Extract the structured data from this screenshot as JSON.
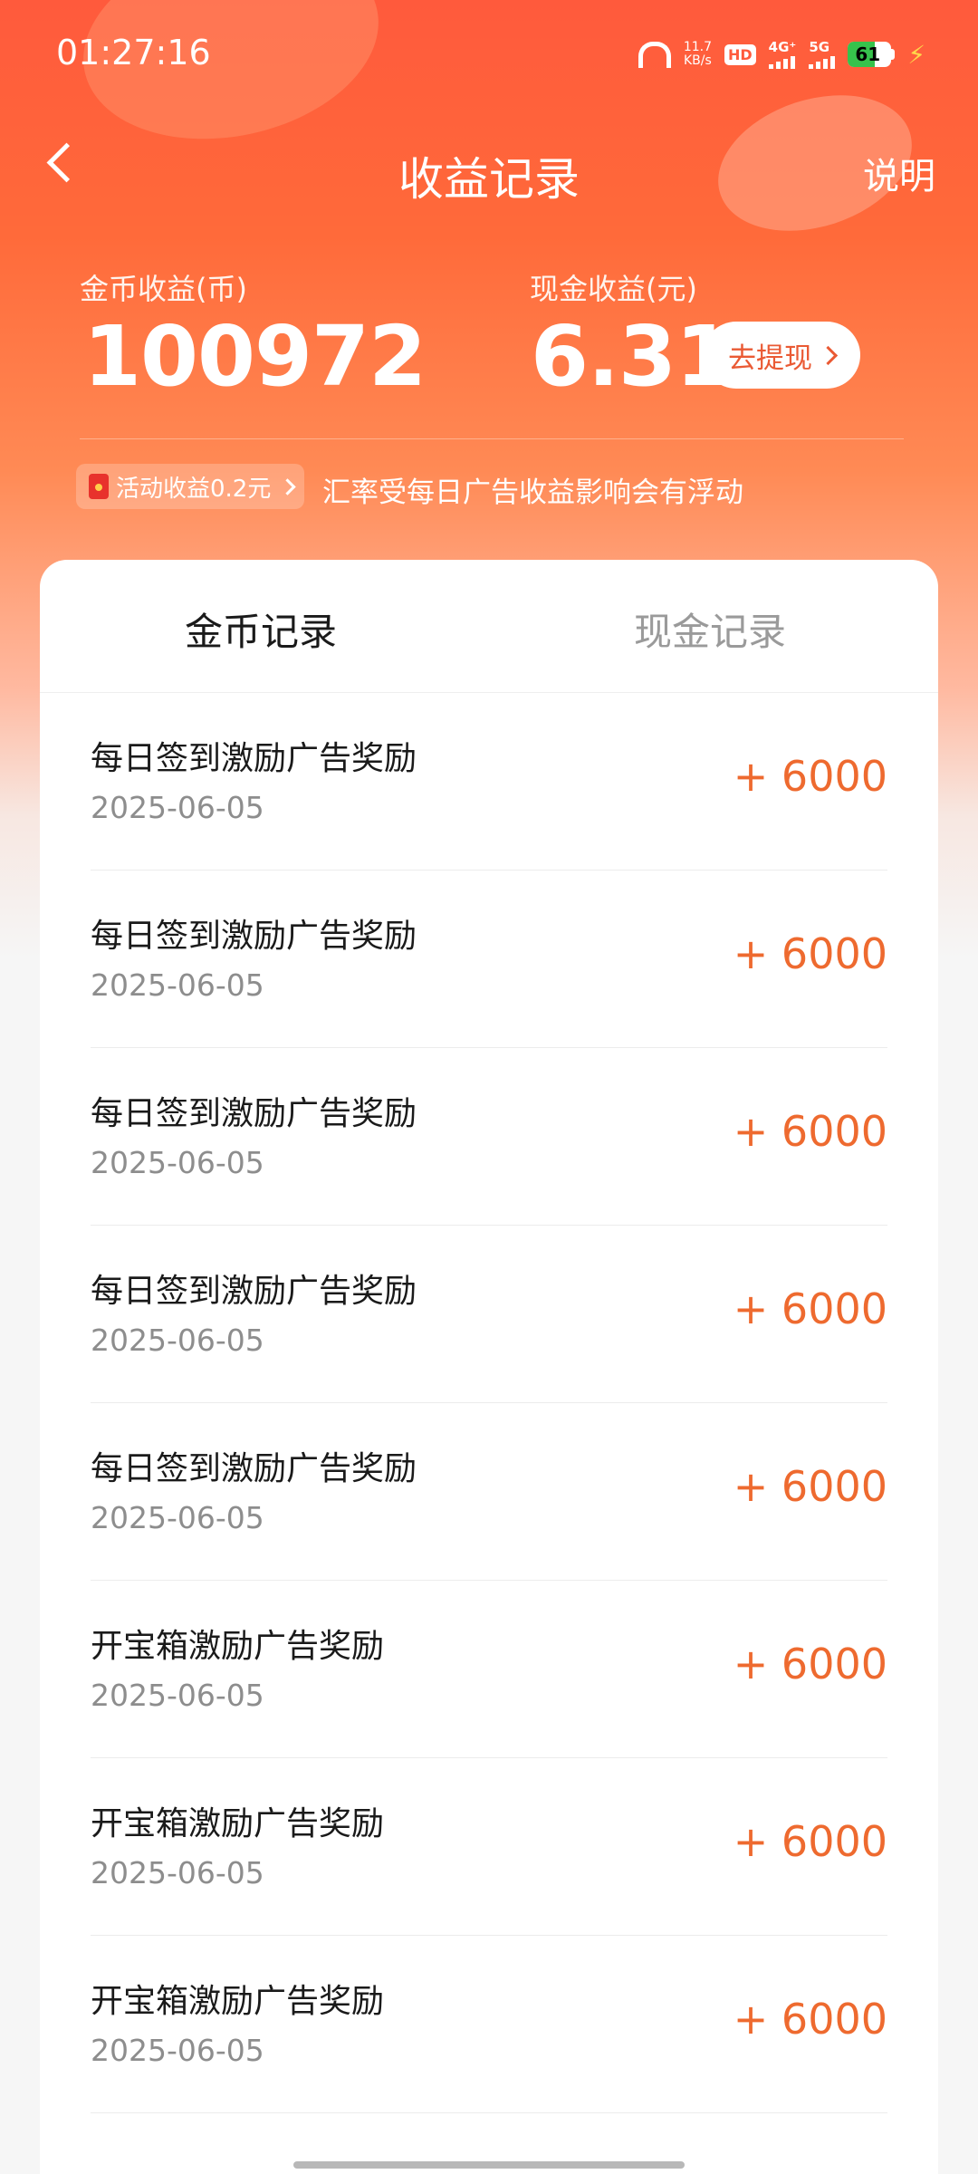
{
  "status_bar": {
    "time": "01:27:16",
    "net_speed_value": "11.7",
    "net_speed_unit": "KB/s",
    "hd_label": "HD",
    "sim1_label": "4G⁺",
    "sim2_label": "5G",
    "battery_percent": 61,
    "battery_text": "61",
    "charging": true
  },
  "header": {
    "title": "收益记录",
    "help_label": "说明"
  },
  "summary": {
    "coin_label": "金币收益(币)",
    "coin_value": "100972",
    "cash_label": "现金收益(元)",
    "cash_value": "6.31",
    "withdraw_label": "去提现",
    "activity_chip_label": "活动收益0.2元",
    "rate_note": "汇率受每日广告收益影响会有浮动"
  },
  "tabs": {
    "coin_records": "金币记录",
    "cash_records": "现金记录",
    "active": "coin_records"
  },
  "records": [
    {
      "title": "每日签到激励广告奖励",
      "date": "2025-06-05",
      "amount": "+ 6000"
    },
    {
      "title": "每日签到激励广告奖励",
      "date": "2025-06-05",
      "amount": "+ 6000"
    },
    {
      "title": "每日签到激励广告奖励",
      "date": "2025-06-05",
      "amount": "+ 6000"
    },
    {
      "title": "每日签到激励广告奖励",
      "date": "2025-06-05",
      "amount": "+ 6000"
    },
    {
      "title": "每日签到激励广告奖励",
      "date": "2025-06-05",
      "amount": "+ 6000"
    },
    {
      "title": "开宝箱激励广告奖励",
      "date": "2025-06-05",
      "amount": "+ 6000"
    },
    {
      "title": "开宝箱激励广告奖励",
      "date": "2025-06-05",
      "amount": "+ 6000"
    },
    {
      "title": "开宝箱激励广告奖励",
      "date": "2025-06-05",
      "amount": "+ 6000"
    }
  ],
  "colors": {
    "brand_orange": "#ff5a3c",
    "amount_orange": "#ee6a2f",
    "battery_green": "#36c24c"
  },
  "icons": {
    "back": "back-icon",
    "headphone": "headphone-icon",
    "envelope": "red-envelope-icon",
    "bolt": "charging-bolt-icon"
  }
}
